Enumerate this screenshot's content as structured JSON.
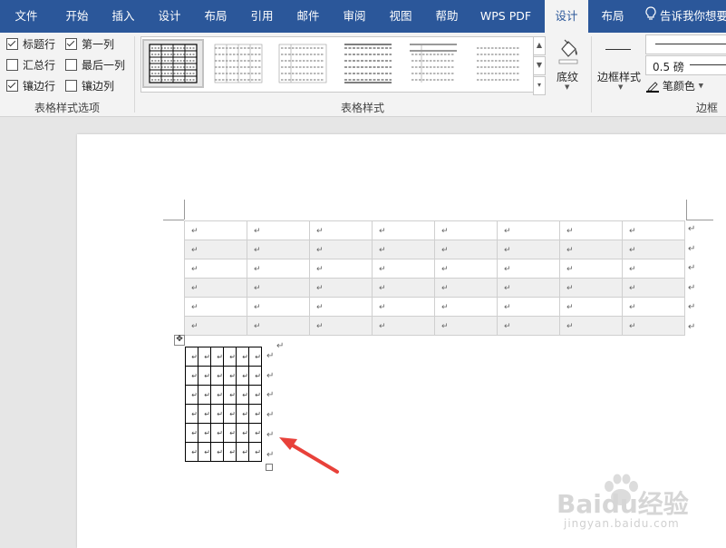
{
  "tabs": [
    {
      "label": "文件",
      "active": false
    },
    {
      "label": "开始",
      "active": false
    },
    {
      "label": "插入",
      "active": false
    },
    {
      "label": "设计",
      "active": false
    },
    {
      "label": "布局",
      "active": false
    },
    {
      "label": "引用",
      "active": false
    },
    {
      "label": "邮件",
      "active": false
    },
    {
      "label": "审阅",
      "active": false
    },
    {
      "label": "视图",
      "active": false
    },
    {
      "label": "帮助",
      "active": false
    },
    {
      "label": "WPS PDF",
      "active": false
    },
    {
      "label": "设计",
      "active": true
    },
    {
      "label": "布局",
      "active": false
    }
  ],
  "tell_me": "告诉我你想要",
  "table_style_options": {
    "group_label": "表格样式选项",
    "options": [
      {
        "label": "标题行",
        "checked": true
      },
      {
        "label": "第一列",
        "checked": true
      },
      {
        "label": "汇总行",
        "checked": false
      },
      {
        "label": "最后一列",
        "checked": false
      },
      {
        "label": "镶边行",
        "checked": true
      },
      {
        "label": "镶边列",
        "checked": false
      }
    ]
  },
  "table_styles": {
    "group_label": "表格样式",
    "selected_index": 0,
    "style_count": 6
  },
  "shading": {
    "label": "底纹"
  },
  "borders": {
    "group_label": "边框",
    "border_styles_label": "边框样式",
    "weight": "0.5 磅",
    "pen_color_label": "笔颜色",
    "pen_color": "#000000"
  },
  "document": {
    "paragraph_mark": "↵",
    "big_table": {
      "rows": 6,
      "cols": 8
    },
    "small_table": {
      "rows": 6,
      "cols": 6
    }
  },
  "annotation": {
    "arrow_color": "#e8413a"
  },
  "watermark": {
    "text": "Baidu经验",
    "url": "jingyan.baidu.com"
  }
}
